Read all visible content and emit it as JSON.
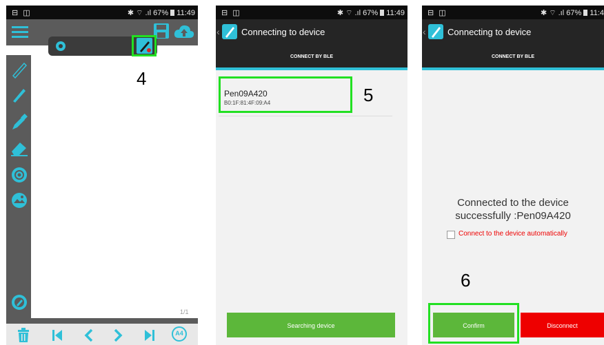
{
  "status_bar": {
    "left_icons": "⊟ ◫",
    "right_icons": "✱ ⌔ .ıl",
    "battery": "67%",
    "time_1": "11:49",
    "time_2": "11:49",
    "time_3": "11:4"
  },
  "screen1": {
    "page_indicator": "1/1",
    "toolbar_label_a4": "A4"
  },
  "screen2": {
    "title": "Connecting to device",
    "tab": "CONNECT BY BLE",
    "device_name": "Pen09A420",
    "device_mac": "B0:1F:81:4F:09:A4",
    "search_button": "Searching device"
  },
  "screen3": {
    "title": "Connecting to device",
    "tab": "CONNECT BY BLE",
    "message_line1": "Connected to the device",
    "message_line2": "successfully :Pen09A420",
    "auto_connect_label": "Connect to the device automatically",
    "confirm_button": "Confirm",
    "disconnect_button": "Disconnect"
  },
  "annotations": {
    "step4": "4",
    "step5": "5",
    "step6": "6"
  },
  "colors": {
    "toolbar_gray": "#5b5b5b",
    "teal": "#2fc0d8",
    "header_dark": "#252525",
    "green_button": "#5cb73a",
    "red_button": "#ee0000",
    "highlight_green": "#22e022"
  }
}
